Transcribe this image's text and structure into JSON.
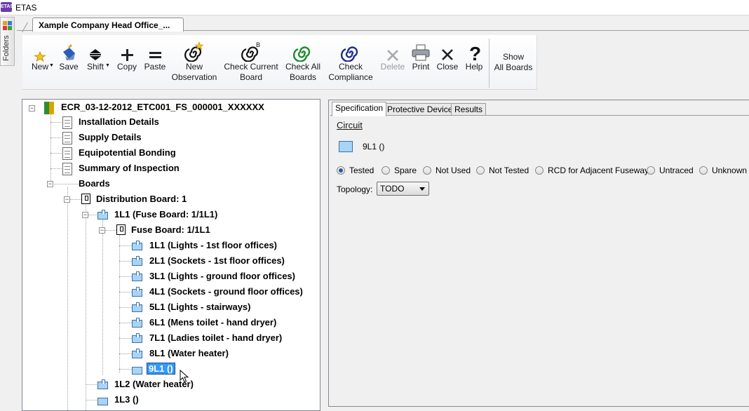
{
  "app": {
    "icon_text": "ETAS",
    "title": "ETAS"
  },
  "folders": {
    "label": "Folders"
  },
  "document_tab": {
    "label": "Xample Company Head Office_..."
  },
  "ribbon": {
    "new": "New",
    "save": "Save",
    "shift": "Shift",
    "copy": "Copy",
    "paste": "Paste",
    "new_observation": [
      "New",
      "Observation"
    ],
    "check_current_board": [
      "Check Current",
      "Board"
    ],
    "check_all_boards": [
      "Check All",
      "Boards"
    ],
    "check_compliance": [
      "Check",
      "Compliance"
    ],
    "delete": "Delete",
    "print": "Print",
    "close": "Close",
    "help": "Help",
    "show_all_boards": [
      "Show",
      "All Boards"
    ]
  },
  "tree": {
    "root": "ECR_03-12-2012_ETC001_FS_000001_XXXXXX",
    "sections": [
      "Installation Details",
      "Supply Details",
      "Equipotential Bonding",
      "Summary of Inspection"
    ],
    "boards_label": "Boards",
    "distribution_board": "Distribution Board: 1",
    "fuse_1l1": "1L1 (Fuse Board: 1/1L1)",
    "fuse_board": "Fuse Board: 1/1L1",
    "circuits": [
      "1L1 (Lights - 1st floor offices)",
      "2L1 (Sockets - 1st floor offices)",
      "3L1 (Lights - ground floor offices)",
      "4L1 (Sockets - ground floor offices)",
      "5L1 (Lights - stairways)",
      "6L1 (Mens toilet - hand dryer)",
      "7L1 (Ladies toilet - hand dryer)",
      "8L1 (Water heater)",
      "9L1 ()"
    ],
    "item_1l2": "1L2 (Water heater)",
    "item_1l3": "1L3 ()"
  },
  "details": {
    "tabs": [
      "Specification",
      "Protective Device",
      "Results"
    ],
    "active_tab": "Specification",
    "circuit_link": "Circuit",
    "circuit_name": "9L1 ()",
    "status_options": [
      "Tested",
      "Spare",
      "Not Used",
      "Not Tested",
      "RCD for Adjacent Fuseway",
      "Untraced",
      "Unknown"
    ],
    "selected_status": "Tested",
    "topology_label": "Topology:",
    "topology_value": "TODO"
  },
  "colors": {
    "selection": "#3399ff",
    "circuit_fill": "#a8d4f5",
    "check_all_green": "#1e8a2e",
    "check_compliance_navy": "#1d2f8a"
  }
}
